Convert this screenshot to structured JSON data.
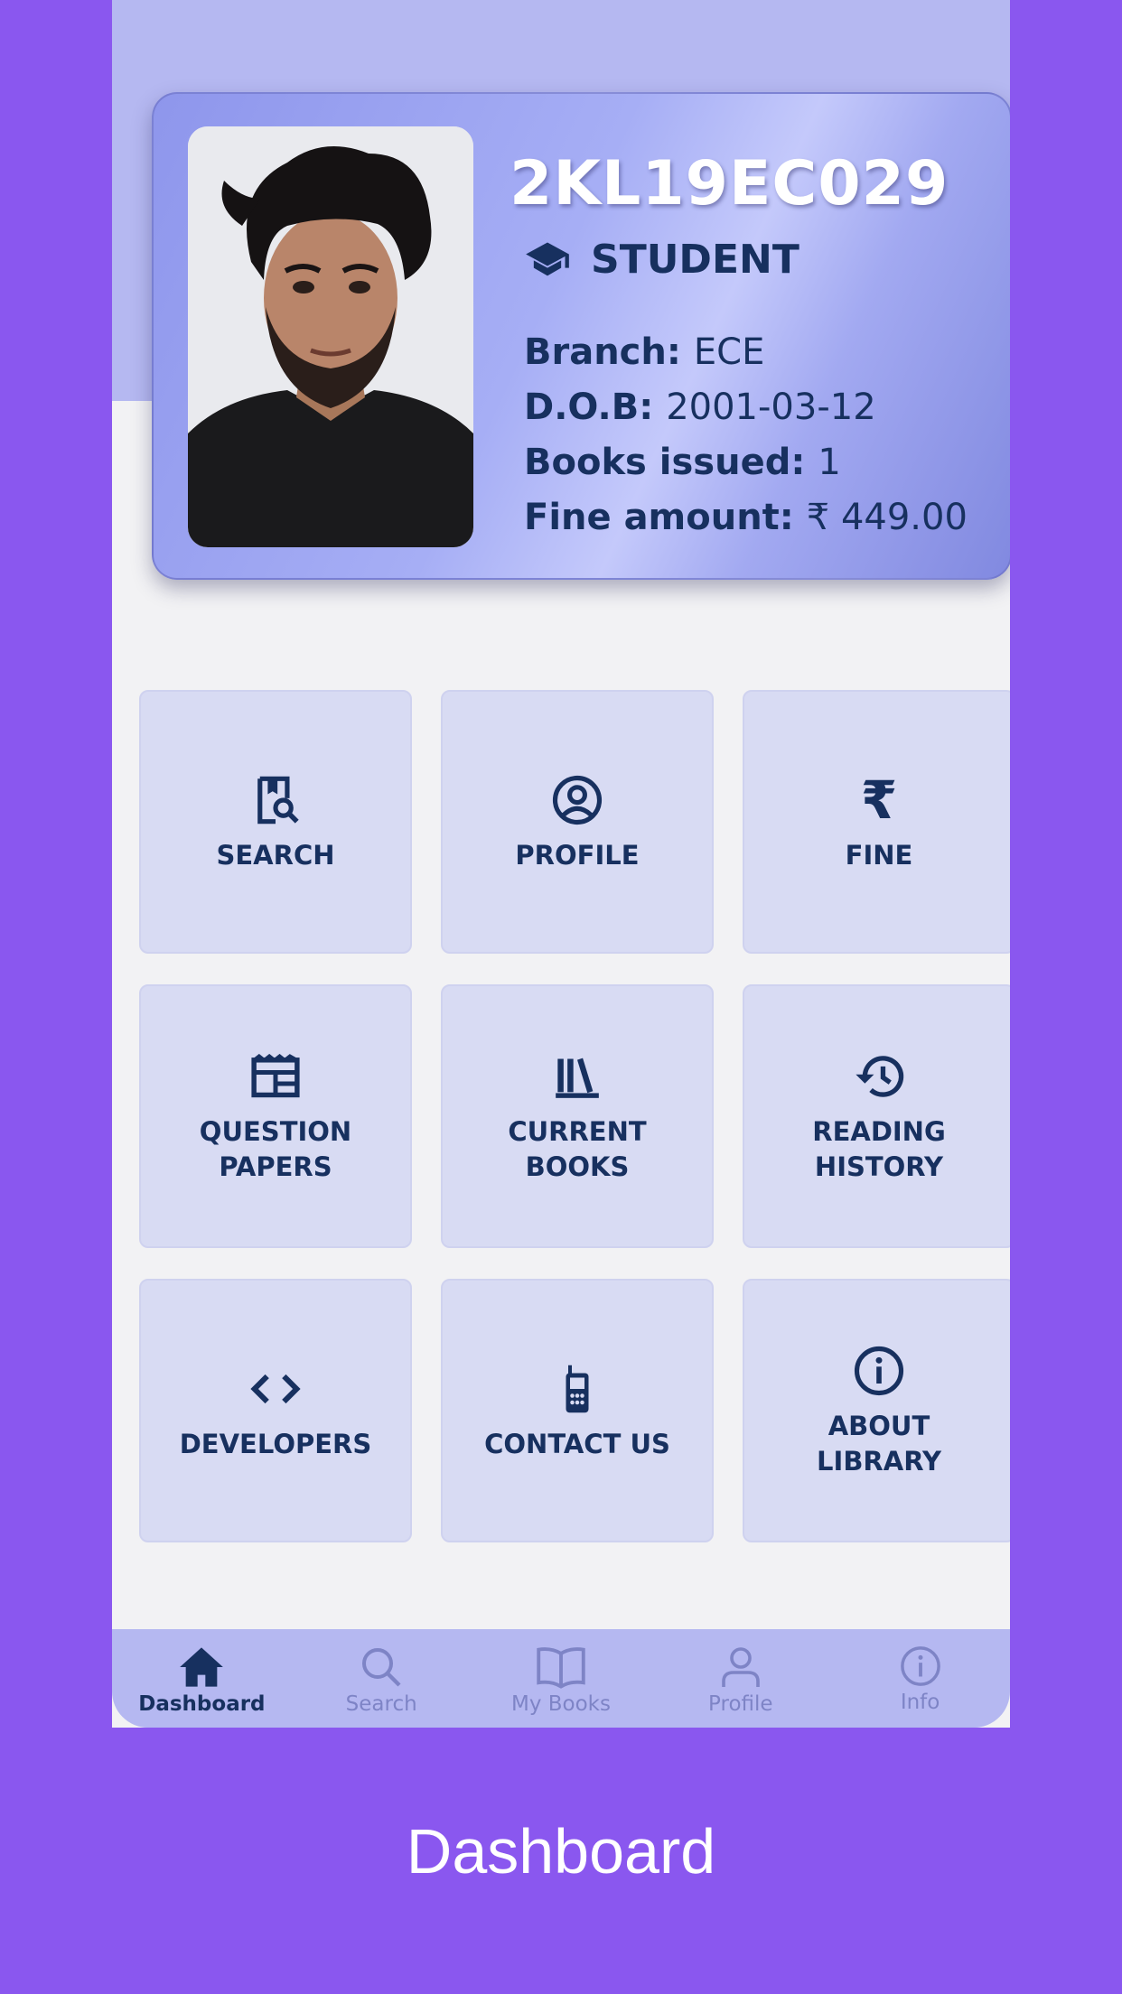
{
  "card": {
    "student_id": "2KL19EC029",
    "role": "STUDENT",
    "fields": [
      {
        "label": "Branch:",
        "value": "ECE"
      },
      {
        "label": "D.O.B:",
        "value": "2001-03-12"
      },
      {
        "label": "Books issued:",
        "value": "1"
      },
      {
        "label": "Fine amount:",
        "value": "₹ 449.00"
      }
    ]
  },
  "tiles": [
    {
      "label": "SEARCH",
      "icon": "book-search-icon"
    },
    {
      "label": "PROFILE",
      "icon": "account-circle-icon"
    },
    {
      "label": "FINE",
      "icon": "rupee-icon"
    },
    {
      "label": "QUESTION\nPAPERS",
      "icon": "newspaper-icon"
    },
    {
      "label": "CURRENT\nBOOKS",
      "icon": "library-books-icon"
    },
    {
      "label": "READING\nHISTORY",
      "icon": "history-icon"
    },
    {
      "label": "DEVELOPERS",
      "icon": "code-icon"
    },
    {
      "label": "CONTACT US",
      "icon": "cellphone-icon"
    },
    {
      "label": "ABOUT\nLIBRARY",
      "icon": "info-icon"
    }
  ],
  "nav": [
    {
      "label": "Dashboard",
      "icon": "home-icon",
      "active": true
    },
    {
      "label": "Search",
      "icon": "search-icon",
      "active": false
    },
    {
      "label": "My Books",
      "icon": "open-book-icon",
      "active": false
    },
    {
      "label": "Profile",
      "icon": "person-icon",
      "active": false
    },
    {
      "label": "Info",
      "icon": "info-icon",
      "active": false
    }
  ],
  "caption": "Dashboard",
  "colors": {
    "background": "#8a57ef",
    "header": "#b5b8f1",
    "tile": "#d8dbf3",
    "text_dark": "#17305f",
    "nav_inactive": "#7e84c6"
  }
}
